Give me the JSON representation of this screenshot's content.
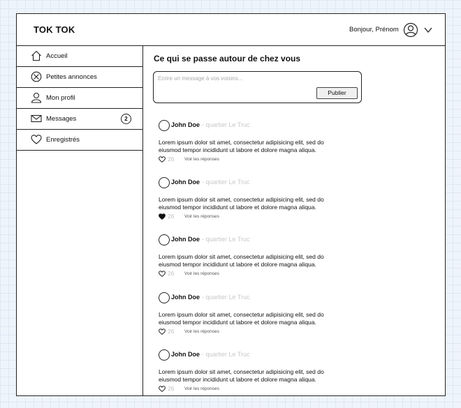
{
  "header": {
    "brand": "TOK TOK",
    "greeting": "Bonjour, Prénom"
  },
  "sidebar": {
    "items": [
      {
        "label": "Accueil",
        "icon": "home-icon"
      },
      {
        "label": "Petites annonces",
        "icon": "circle-x-icon"
      },
      {
        "label": "Mon profil",
        "icon": "user-icon"
      },
      {
        "label": "Messages",
        "icon": "mail-icon",
        "badge": "2"
      },
      {
        "label": "Enregistrés",
        "icon": "heart-icon"
      }
    ]
  },
  "main": {
    "title": "Ce qui se passe autour de chez vous",
    "composer": {
      "placeholder": "Ecrire un message à vos voisins...",
      "publish_label": "Publier"
    },
    "posts": [
      {
        "author": "John Doe",
        "location": "- quartier Le Truc",
        "line1": "Lorem ipsum dolor sit amet, consectetur adipisicing elit, sed do",
        "line2": "eiusmod tempor incididunt ut labore et dolore magna aliqua.",
        "likes": "26",
        "liked": false,
        "replies": "Voir les réponses"
      },
      {
        "author": "John Doe",
        "location": "- quartier Le Truc",
        "line1": "Lorem ipsum dolor sit amet, consectetur adipisicing elit, sed do",
        "line2": "eiusmod tempor incididunt ut labore et dolore magna aliqua.",
        "likes": "26",
        "liked": true,
        "replies": "Voir les réponses"
      },
      {
        "author": "John Doe",
        "location": "- quartier Le Truc",
        "line1": "Lorem ipsum dolor sit amet, consectetur adipisicing elit, sed do",
        "line2": "eiusmod tempor incididunt ut labore et dolore magna aliqua.",
        "likes": "26",
        "liked": false,
        "replies": "Voir les réponses"
      },
      {
        "author": "John Doe",
        "location": "- quartier Le Truc",
        "line1": "Lorem ipsum dolor sit amet, consectetur adipisicing elit, sed do",
        "line2": "eiusmod tempor incididunt ut labore et dolore magna aliqua.",
        "likes": "26",
        "liked": false,
        "replies": "Voir les réponses"
      },
      {
        "author": "John Doe",
        "location": "- quartier Le Truc",
        "line1": "Lorem ipsum dolor sit amet, consectetur adipisicing elit, sed do",
        "line2": "eiusmod tempor incididunt ut labore et dolore magna aliqua.",
        "likes": "26",
        "liked": false,
        "replies": "Voir les réponses"
      }
    ]
  }
}
